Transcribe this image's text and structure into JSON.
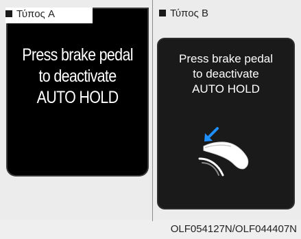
{
  "type_a": {
    "label": "Τύπος A",
    "message_lines": [
      "Press brake pedal",
      "to deactivate",
      "AUTO HOLD"
    ]
  },
  "type_b": {
    "label": "Τύπος B",
    "message_lines": [
      "Press brake pedal",
      "to deactivate",
      "AUTO HOLD"
    ],
    "icon": "brake-pedal-press-icon",
    "arrow_color": "#1e90ff"
  },
  "caption": "OLF054127N/OLF044407N"
}
